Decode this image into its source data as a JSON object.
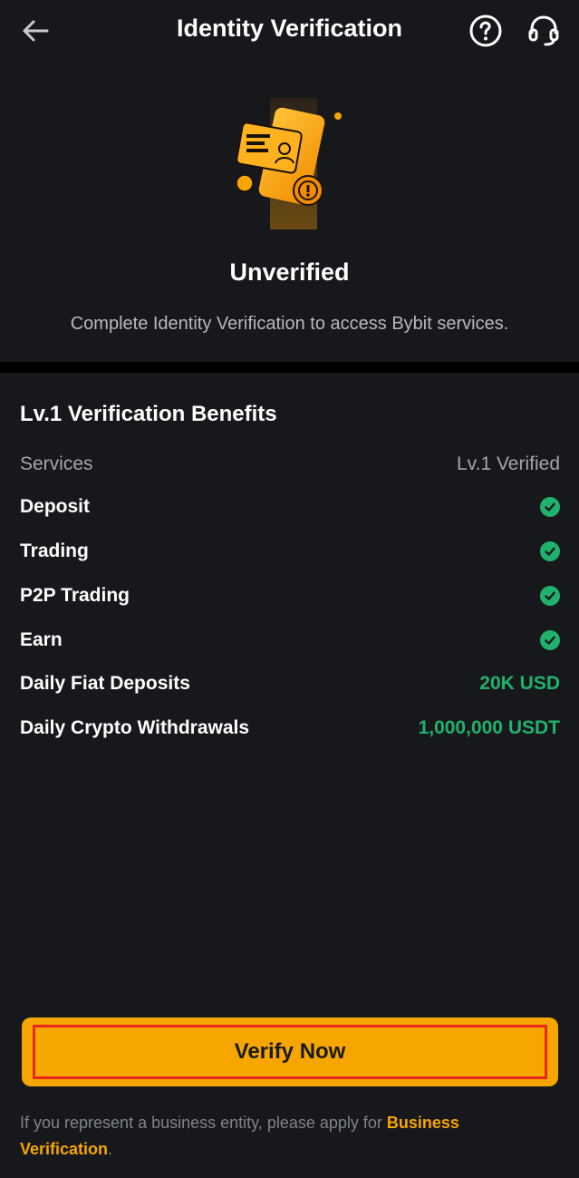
{
  "header": {
    "title": "Identity Verification",
    "back_icon": "arrow-left-icon",
    "help_icon": "question-circle-icon",
    "support_icon": "headset-icon"
  },
  "status": {
    "title": "Unverified",
    "subtitle": "Complete Identity Verification to access Bybit services."
  },
  "benefits": {
    "title": "Lv.1 Verification Benefits",
    "column_headers": {
      "services": "Services",
      "level": "Lv.1 Verified"
    },
    "rows": [
      {
        "label": "Deposit",
        "value": "check"
      },
      {
        "label": "Trading",
        "value": "check"
      },
      {
        "label": "P2P Trading",
        "value": "check"
      },
      {
        "label": "Earn",
        "value": "check"
      },
      {
        "label": "Daily Fiat Deposits",
        "value": "20K USD"
      },
      {
        "label": "Daily Crypto Withdrawals",
        "value": "1,000,000 USDT"
      }
    ]
  },
  "verify_button": {
    "label": "Verify Now"
  },
  "footer": {
    "text": "If you represent a business entity, please apply for ",
    "link": "Business Verification",
    "end": "."
  },
  "colors": {
    "background": "#17181c",
    "accent": "#f7a600",
    "success": "#20b26c",
    "highlight_border": "#e8261b"
  }
}
